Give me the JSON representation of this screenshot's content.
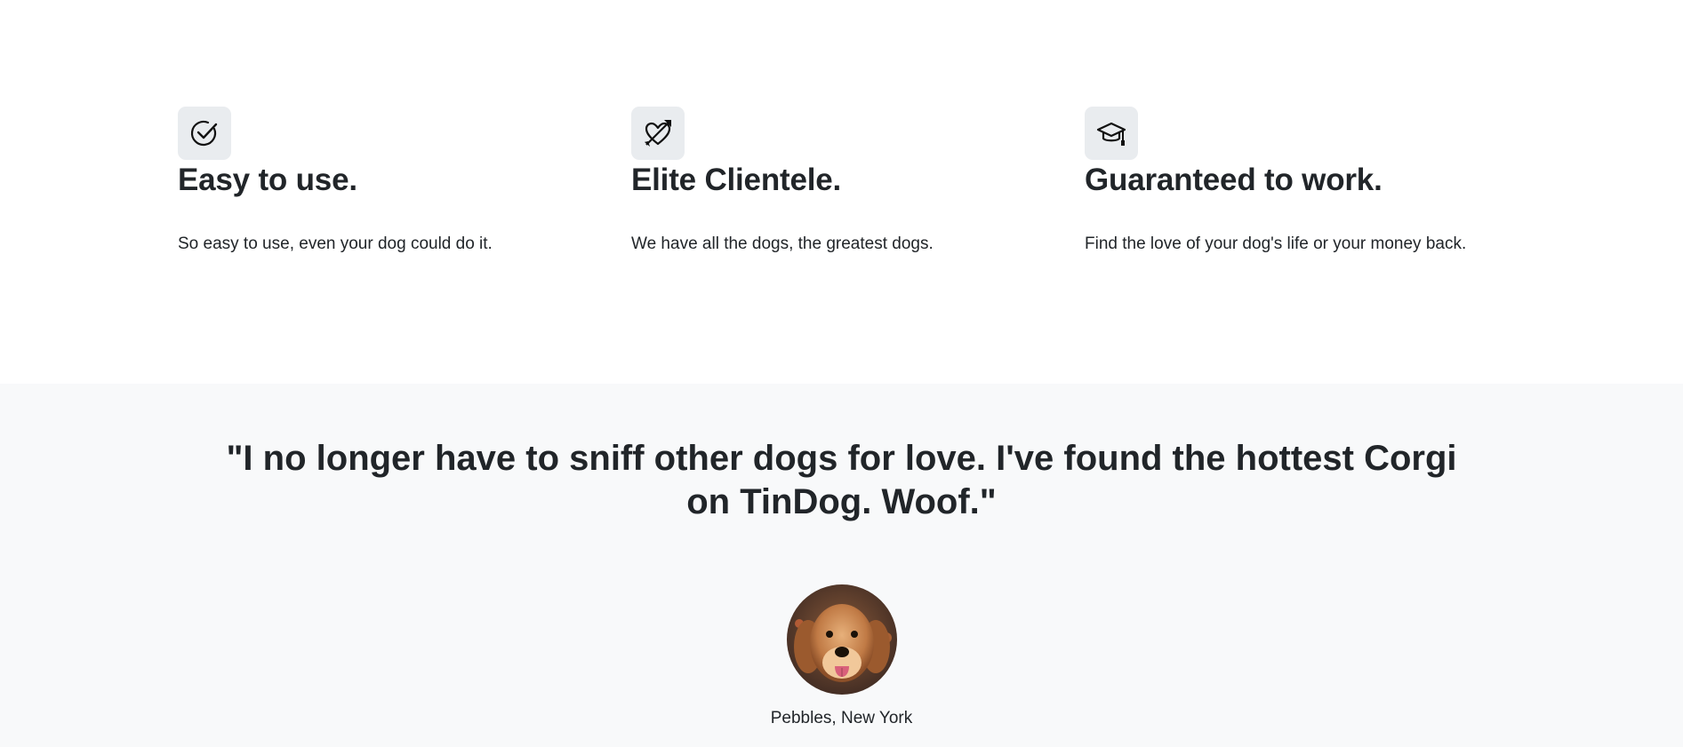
{
  "features": [
    {
      "icon": "check-circle-icon",
      "title": "Easy to use.",
      "description": "So easy to use, even your dog could do it."
    },
    {
      "icon": "heart-arrow-icon",
      "title": "Elite Clientele.",
      "description": "We have all the dogs, the greatest dogs."
    },
    {
      "icon": "graduation-cap-icon",
      "title": "Guaranteed to work.",
      "description": "Find the love of your dog's life or your money back."
    }
  ],
  "testimonial": {
    "quote": "\"I no longer have to sniff other dogs for love. I've found the hottest Corgi on TinDog. Woof.\"",
    "attribution": "Pebbles, New York"
  },
  "colors": {
    "text": "#212529",
    "icon_bg": "#e9ecef",
    "testimonial_bg": "#f8f9fa"
  }
}
